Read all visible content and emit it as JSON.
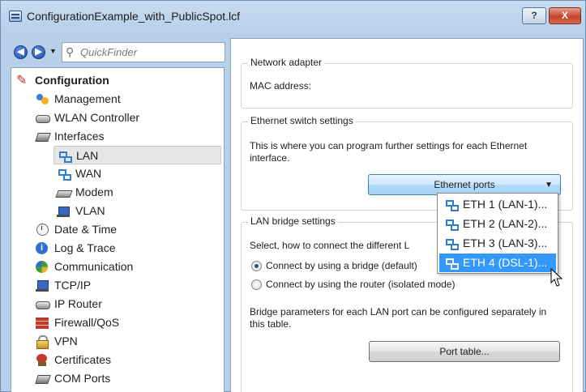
{
  "window": {
    "title": "ConfigurationExample_with_PublicSpot.lcf",
    "help_label": "?",
    "close_label": "X"
  },
  "nav": {
    "quickfinder_placeholder": "QuickFinder"
  },
  "tree": [
    {
      "label": "Configuration",
      "icon": "configuration-icon",
      "level": 0
    },
    {
      "label": "Management",
      "icon": "management-icon",
      "level": 1
    },
    {
      "label": "WLAN Controller",
      "icon": "router-icon",
      "level": 1
    },
    {
      "label": "Interfaces",
      "icon": "interfaces-icon",
      "level": 1
    },
    {
      "label": "LAN",
      "icon": "network-icon",
      "level": 2,
      "selected": true
    },
    {
      "label": "WAN",
      "icon": "network-icon",
      "level": 2
    },
    {
      "label": "Modem",
      "icon": "modem-icon",
      "level": 2
    },
    {
      "label": "VLAN",
      "icon": "vlan-icon",
      "level": 2
    },
    {
      "label": "Date & Time",
      "icon": "clock-icon",
      "level": 1
    },
    {
      "label": "Log & Trace",
      "icon": "info-icon",
      "level": 1
    },
    {
      "label": "Communication",
      "icon": "communication-icon",
      "level": 1
    },
    {
      "label": "TCP/IP",
      "icon": "tcpip-icon",
      "level": 1
    },
    {
      "label": "IP Router",
      "icon": "router-icon",
      "level": 1
    },
    {
      "label": "Firewall/QoS",
      "icon": "firewall-icon",
      "level": 1
    },
    {
      "label": "VPN",
      "icon": "lock-icon",
      "level": 1
    },
    {
      "label": "Certificates",
      "icon": "certificate-icon",
      "level": 1
    },
    {
      "label": "COM Ports",
      "icon": "com-port-icon",
      "level": 1
    }
  ],
  "network_adapter": {
    "title": "Network adapter",
    "mac_label": "MAC address:"
  },
  "ethernet_switch": {
    "title": "Ethernet switch settings",
    "description": "This is where you can program further settings for each Ethernet interface.",
    "button_label": "Ethernet ports"
  },
  "ethernet_menu": [
    {
      "label": "ETH 1 (LAN-1)..."
    },
    {
      "label": "ETH 2 (LAN-2)..."
    },
    {
      "label": "ETH 3 (LAN-3)..."
    },
    {
      "label": "ETH 4 (DSL-1)...",
      "highlighted": true
    }
  ],
  "lan_bridge": {
    "title": "LAN bridge settings",
    "description_visible": "Select, how to connect the different L",
    "radio_bridge": "Connect by using a bridge (default)",
    "radio_router": "Connect by using the router (isolated mode)",
    "selected_radio": "Connect by using a bridge (default)",
    "bridge_params": "Bridge parameters for each LAN port can be configured separately in this table.",
    "port_table_label": "Port table..."
  }
}
